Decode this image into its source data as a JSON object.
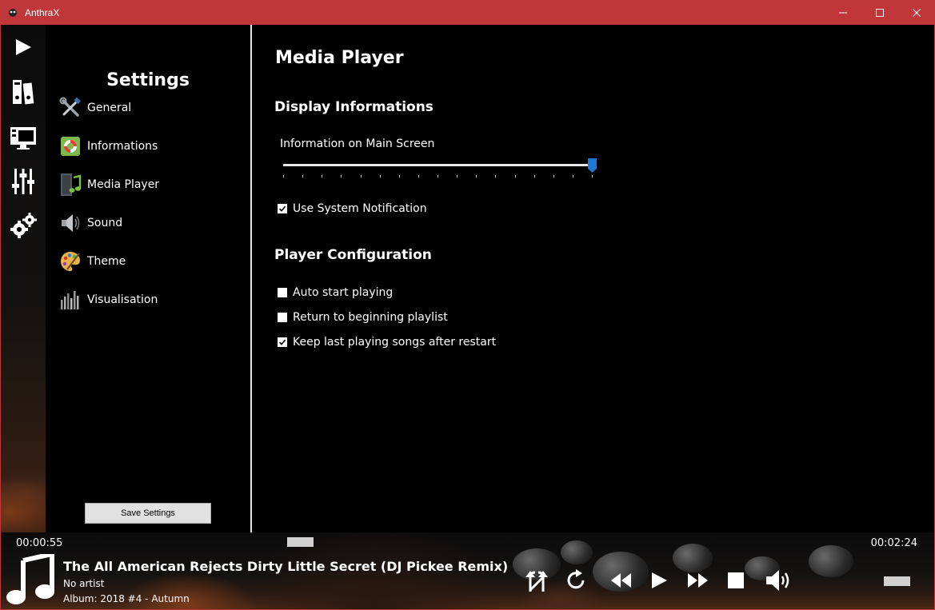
{
  "window": {
    "title": "AnthraX",
    "controls": {
      "minimize": "minimize-icon",
      "maximize": "maximize-icon",
      "close": "close-icon"
    },
    "frame_color": "#c0373a"
  },
  "rail": {
    "items": [
      {
        "icon": "play-icon"
      },
      {
        "icon": "library-icon"
      },
      {
        "icon": "monitor-icon"
      },
      {
        "icon": "equalizer-icon"
      },
      {
        "icon": "settings-gears-icon"
      }
    ]
  },
  "settings_nav": {
    "title": "Settings",
    "items": [
      {
        "label": "General",
        "icon": "tools-icon"
      },
      {
        "label": "Informations",
        "icon": "lifebuoy-icon"
      },
      {
        "label": "Media Player",
        "icon": "media-player-icon"
      },
      {
        "label": "Sound",
        "icon": "speaker-icon"
      },
      {
        "label": "Theme",
        "icon": "palette-icon"
      },
      {
        "label": "Visualisation",
        "icon": "bars-icon"
      }
    ],
    "save_label": "Save Settings"
  },
  "main": {
    "title": "Media Player",
    "display_section": {
      "title": "Display Informations",
      "slider_label": "Information on Main Screen",
      "slider_fraction": 1.0,
      "accent": "#1e78d6",
      "checkboxes": [
        {
          "label": "Use System Notification",
          "checked": true
        }
      ]
    },
    "player_section": {
      "title": "Player Configuration",
      "checkboxes": [
        {
          "label": "Auto start playing",
          "checked": false
        },
        {
          "label": "Return to beginning playlist",
          "checked": false
        },
        {
          "label": "Keep last playing songs after restart",
          "checked": true
        }
      ]
    }
  },
  "player": {
    "elapsed": "00:00:55",
    "duration": "00:02:24",
    "title": "The All American Rejects  Dirty Little Secret (DJ Pickee Remix)",
    "artist": "No artist",
    "album": "Album: 2018 #4 - Autumn",
    "controls": [
      "shuffle-icon",
      "repeat-icon",
      "rewind-icon",
      "play-icon",
      "fast-forward-icon",
      "stop-icon",
      "volume-icon"
    ]
  }
}
